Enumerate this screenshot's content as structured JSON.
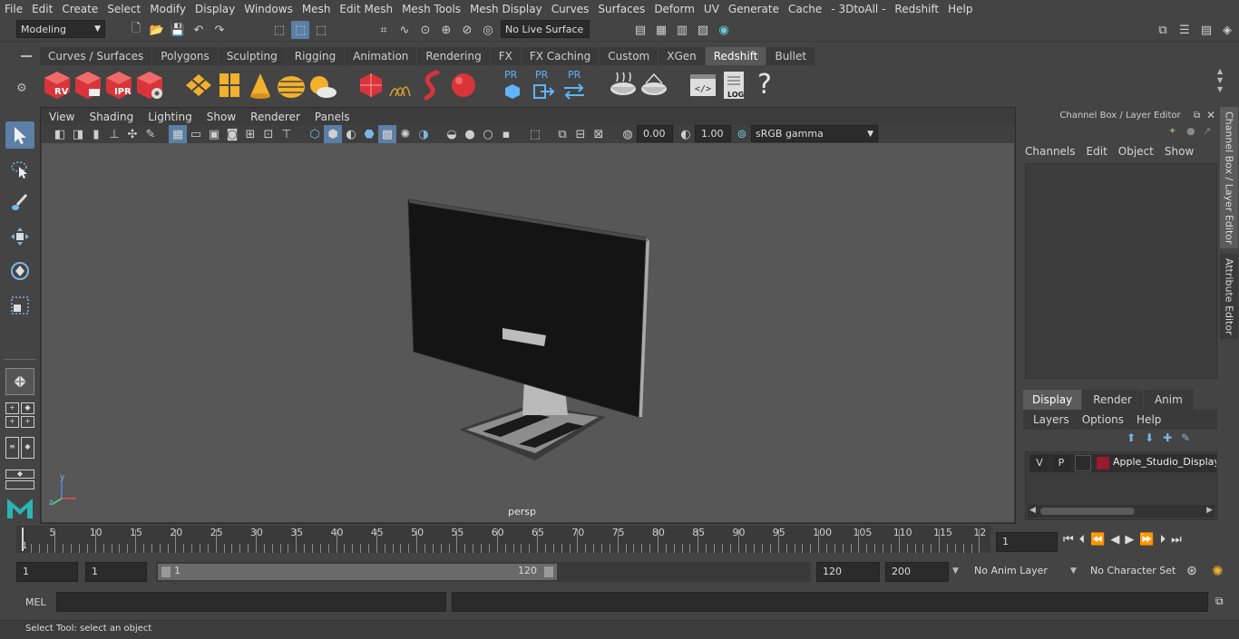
{
  "menu": [
    "File",
    "Edit",
    "Create",
    "Select",
    "Modify",
    "Display",
    "Windows",
    "Mesh",
    "Edit Mesh",
    "Mesh Tools",
    "Mesh Display",
    "Curves",
    "Surfaces",
    "Deform",
    "UV",
    "Generate",
    "Cache",
    "- 3DtoAll -",
    "Redshift",
    "Help"
  ],
  "toolbar": {
    "mode": "Modeling",
    "live_surface": "No Live Surface"
  },
  "shelf_tabs": [
    "Curves / Surfaces",
    "Polygons",
    "Sculpting",
    "Rigging",
    "Animation",
    "Rendering",
    "FX",
    "FX Caching",
    "Custom",
    "XGen",
    "Redshift",
    "Bullet"
  ],
  "shelf_active": "Redshift",
  "shelf_labels": {
    "rv": "RV",
    "ipr": "IPR",
    "pr1": "PR",
    "pr2": "PR",
    "pr3": "PR",
    "log": "LOG",
    "help": "?"
  },
  "viewport": {
    "menu": [
      "View",
      "Shading",
      "Lighting",
      "Show",
      "Renderer",
      "Panels"
    ],
    "exposure": "0.00",
    "gamma": "1.00",
    "colorspace": "sRGB gamma",
    "camera": "persp",
    "axis_y": "y",
    "axis_z": "z"
  },
  "channel_box": {
    "title": "Channel Box / Layer Editor",
    "menu": [
      "Channels",
      "Edit",
      "Object",
      "Show"
    ]
  },
  "layer_editor": {
    "tabs": [
      "Display",
      "Render",
      "Anim"
    ],
    "active_tab": "Display",
    "menu": [
      "Layers",
      "Options",
      "Help"
    ],
    "layer": {
      "v": "V",
      "p": "P",
      "name": "Apple_Studio_Display_",
      "color": "#9a1b2b"
    }
  },
  "side_tabs": [
    "Channel Box / Layer Editor",
    "Attribute Editor"
  ],
  "timeline": {
    "ticks": [
      "5",
      "10",
      "15",
      "20",
      "25",
      "30",
      "35",
      "40",
      "45",
      "50",
      "55",
      "60",
      "65",
      "70",
      "75",
      "80",
      "85",
      "90",
      "95",
      "100",
      "105",
      "110",
      "115",
      "12"
    ],
    "start_marker": "1",
    "current_frame": "1"
  },
  "range": {
    "start": "1",
    "playback_start": "1",
    "slider_start": "1",
    "slider_end": "120",
    "end": "120",
    "anim_end": "200",
    "anim_layer": "No Anim Layer",
    "character_set": "No Character Set"
  },
  "command": {
    "lang": "MEL"
  },
  "help_text": "Select Tool: select an object"
}
